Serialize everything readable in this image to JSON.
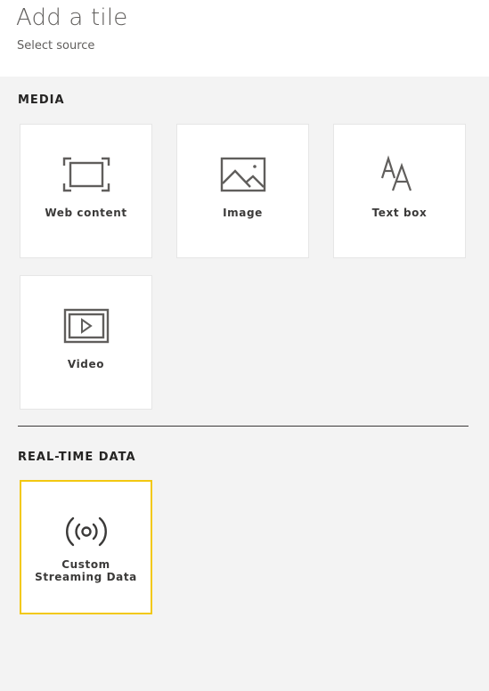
{
  "header": {
    "title": "Add a tile",
    "subtitle": "Select source"
  },
  "sections": {
    "media": {
      "label": "MEDIA",
      "tiles": [
        {
          "label": "Web content",
          "icon": "web-content-icon"
        },
        {
          "label": "Image",
          "icon": "image-icon"
        },
        {
          "label": "Text box",
          "icon": "text-box-icon"
        },
        {
          "label": "Video",
          "icon": "video-icon"
        }
      ]
    },
    "realtime": {
      "label": "REAL-TIME DATA",
      "tiles": [
        {
          "label_line1": "Custom",
          "label_line2": "Streaming Data",
          "icon": "streaming-icon",
          "selected": true
        }
      ]
    }
  },
  "colors": {
    "background": "#f3f3f3",
    "tile": "#ffffff",
    "selected_border": "#f2c811",
    "icon": "#605e5c"
  }
}
